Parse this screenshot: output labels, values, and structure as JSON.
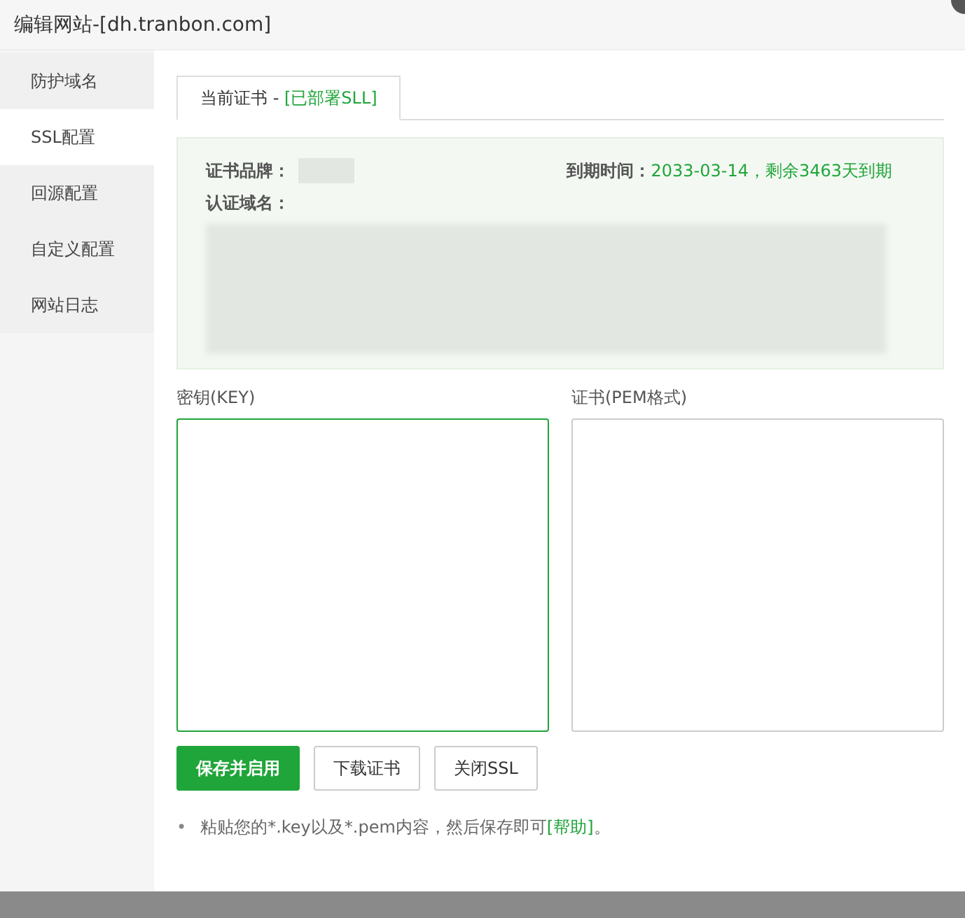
{
  "window": {
    "title": "编辑网站-[dh.tranbon.com]"
  },
  "sidebar": {
    "items": [
      {
        "label": "防护域名",
        "selected": false
      },
      {
        "label": "SSL配置",
        "selected": true
      },
      {
        "label": "回源配置",
        "selected": false
      },
      {
        "label": "自定义配置",
        "selected": false
      },
      {
        "label": "网站日志",
        "selected": false
      }
    ]
  },
  "tabs": [
    {
      "label": "当前证书 - ",
      "status": "[已部署SLL]",
      "selected": true
    }
  ],
  "cert_info": {
    "brand_label": "证书品牌：",
    "expiry_label": "到期时间：",
    "expiry_value": "2033-03-14，剩余3463天到期",
    "domain_label": "认证域名："
  },
  "fields": [
    {
      "label": "密钥(KEY)",
      "focused": true
    },
    {
      "label": "证书(PEM格式)",
      "focused": false
    }
  ],
  "buttons": [
    {
      "label": "保存并启用",
      "kind": "primary"
    },
    {
      "label": "下载证书",
      "kind": "default"
    },
    {
      "label": "关闭SSL",
      "kind": "default"
    }
  ],
  "notes": [
    {
      "bullet": "•",
      "text": "粘贴您的*.key以及*.pem内容，然后保存即可",
      "link": "[帮助]",
      "suffix": "。"
    }
  ]
}
